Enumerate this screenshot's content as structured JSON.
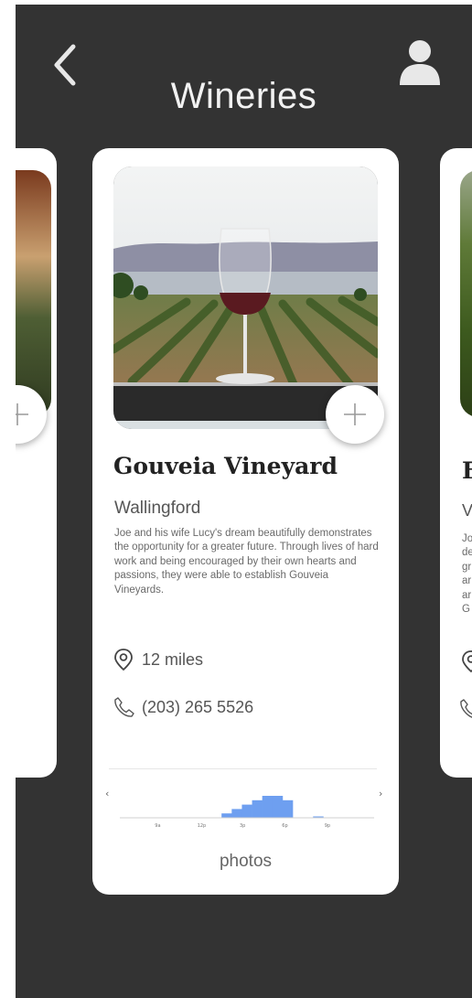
{
  "header": {
    "title": "Wineries",
    "back_icon": "chevron-left-icon",
    "profile_icon": "user-icon"
  },
  "main_card": {
    "name": "Gouveia Vineyard",
    "city": "Wallingford",
    "description": "Joe and his wife Lucy's dream beautifully demonstrates the opportunity for a greater future. Through lives of hard work and being encouraged by their own hearts and passions, they were able to establish Gouveia Vineyards.",
    "distance": "12 miles",
    "phone": "(203) 265 5526",
    "add_icon": "plus-icon",
    "photos_label": "photos"
  },
  "right_card_peek": {
    "name_initial": "F",
    "city_initial": "V",
    "desc_line_starts": [
      "Jo",
      "de",
      "gr",
      "ar",
      "ar",
      "G"
    ]
  },
  "chart_data": {
    "type": "bar",
    "title": "",
    "x_tick_labels": [
      "9a",
      "12p",
      "3p",
      "6p",
      "9p"
    ],
    "values": [
      0,
      0,
      0,
      0,
      0,
      0,
      0,
      0,
      0,
      0,
      1,
      2,
      3,
      4,
      5,
      5,
      4,
      0,
      0,
      0.1,
      0,
      0,
      0,
      0,
      0
    ],
    "ylim": [
      0,
      5
    ],
    "prev_icon": "chevron-left-icon",
    "next_icon": "chevron-right-icon"
  },
  "colors": {
    "background": "#333333",
    "card": "#ffffff",
    "bar": "#6e9ff0"
  }
}
